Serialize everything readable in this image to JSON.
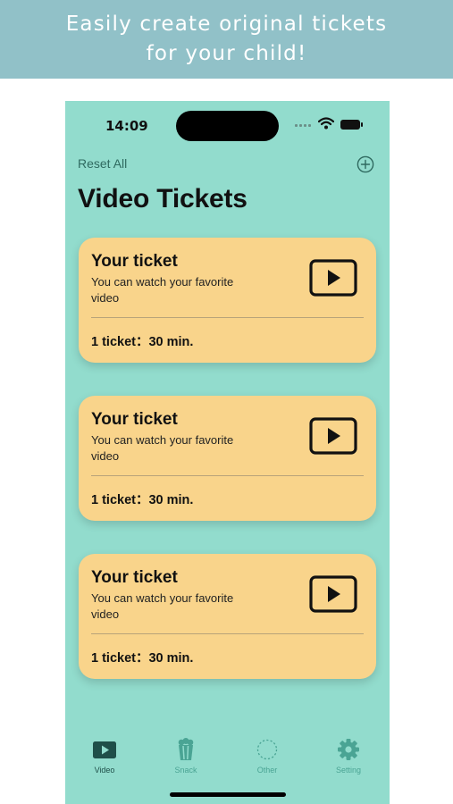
{
  "banner": {
    "line1": "Easily create original tickets",
    "line2": "for your child!"
  },
  "status_bar": {
    "time": "14:09"
  },
  "nav": {
    "reset_label": "Reset All",
    "add_icon": "plus-circle-icon"
  },
  "page": {
    "title": "Video Tickets"
  },
  "tickets": [
    {
      "title": "Your ticket",
      "description": "You can watch your favorite video",
      "rate": "1 ticket：30 min.",
      "icon": "play-video-icon"
    },
    {
      "title": "Your ticket",
      "description": "You can watch your favorite video",
      "rate": "1 ticket：30 min.",
      "icon": "play-video-icon"
    },
    {
      "title": "Your ticket",
      "description": "You can watch your favorite video",
      "rate": "1 ticket：30 min.",
      "icon": "play-video-icon"
    }
  ],
  "tabbar": {
    "tabs": [
      {
        "label": "Video",
        "icon": "video-icon",
        "active": true
      },
      {
        "label": "Snack",
        "icon": "popcorn-icon",
        "active": false
      },
      {
        "label": "Other",
        "icon": "dashed-circle-icon",
        "active": false
      },
      {
        "label": "Setting",
        "icon": "gear-icon",
        "active": false
      }
    ]
  },
  "colors": {
    "banner_bg": "#91c1c8",
    "app_bg": "#92dccd",
    "card_bg": "#f9d48b",
    "active_tab": "#1f4f49",
    "inactive_tab": "#4aa494"
  }
}
